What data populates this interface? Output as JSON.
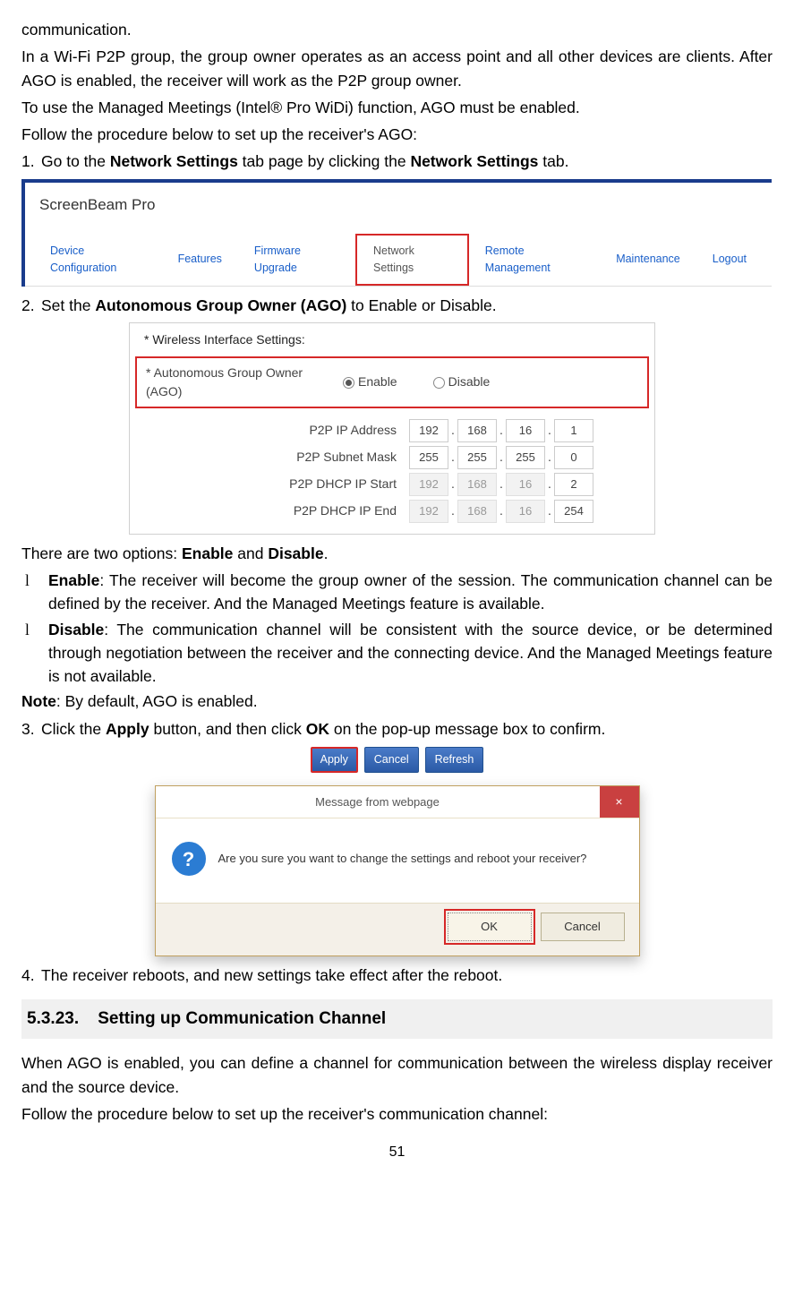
{
  "intro": {
    "line0": "communication.",
    "line1": "In a Wi-Fi P2P group, the group owner operates as an access point and all other devices are clients. After AGO is enabled, the receiver will work as the P2P group owner.",
    "line2": "To use the Managed Meetings (Intel® Pro WiDi) function, AGO must be enabled.",
    "line3": "Follow the procedure below to set up the receiver's AGO:"
  },
  "step1": {
    "num": "1.",
    "pre": "Go to the ",
    "b1": "Network Settings",
    "mid": " tab page by clicking the ",
    "b2": "Network Settings",
    "post": " tab."
  },
  "tabs": {
    "brand": "ScreenBeam Pro",
    "items": [
      "Device Configuration",
      "Features",
      "Firmware Upgrade",
      "Network Settings",
      "Remote Management",
      "Maintenance",
      "Logout"
    ]
  },
  "step2": {
    "num": "2.",
    "pre": "Set the ",
    "b1": "Autonomous Group Owner (AGO)",
    "post": " to Enable or Disable."
  },
  "wl": {
    "header": "* Wireless Interface Settings:",
    "ago_label": "* Autonomous Group Owner (AGO)",
    "enable": "Enable",
    "disable": "Disable",
    "rows": [
      {
        "label": "P2P IP Address",
        "v": [
          "192",
          "168",
          "16",
          "1"
        ],
        "dis": false
      },
      {
        "label": "P2P Subnet Mask",
        "v": [
          "255",
          "255",
          "255",
          "0"
        ],
        "dis": false
      },
      {
        "label": "P2P DHCP IP Start",
        "v": [
          "192",
          "168",
          "16",
          "2"
        ],
        "dis": true
      },
      {
        "label": "P2P DHCP IP End",
        "v": [
          "192",
          "168",
          "16",
          "254"
        ],
        "dis": true
      }
    ]
  },
  "options_intro_pre": "There are two options: ",
  "options_intro_b1": "Enable",
  "options_intro_mid": " and ",
  "options_intro_b2": "Disable",
  "options_intro_post": ".",
  "opt_enable": {
    "b": "Enable",
    "text": ": The receiver will become the group owner of the session. The communication channel can be defined by the receiver. And the Managed Meetings feature is available."
  },
  "opt_disable": {
    "b": "Disable",
    "text": ": The communication channel will be consistent with the source device, or be determined through negotiation between the receiver and the connecting device. And the Managed Meetings feature is not available."
  },
  "note": {
    "b": "Note",
    "text": ": By default, AGO is enabled."
  },
  "step3": {
    "num": "3.",
    "pre": "Click the ",
    "b1": "Apply",
    "mid": " button, and then click ",
    "b2": "OK",
    "post": " on the pop-up message box to confirm."
  },
  "btnbar": {
    "apply": "Apply",
    "cancel": "Cancel",
    "refresh": "Refresh"
  },
  "dialog": {
    "title": "Message from webpage",
    "msg": "Are you sure you want to change the settings and reboot your receiver?",
    "ok": "OK",
    "cancel": "Cancel",
    "x": "×"
  },
  "step4": {
    "num": "4.",
    "text": "The receiver reboots, and new settings take effect after the reboot."
  },
  "section": {
    "num": "5.3.23.",
    "title": "Setting up Communication Channel"
  },
  "outro": {
    "p1": "When AGO is enabled, you can define a channel for communication between the wireless display receiver and the source device.",
    "p2": "Follow the procedure below to set up the receiver's communication channel:"
  },
  "page": "51",
  "bullet": "l"
}
